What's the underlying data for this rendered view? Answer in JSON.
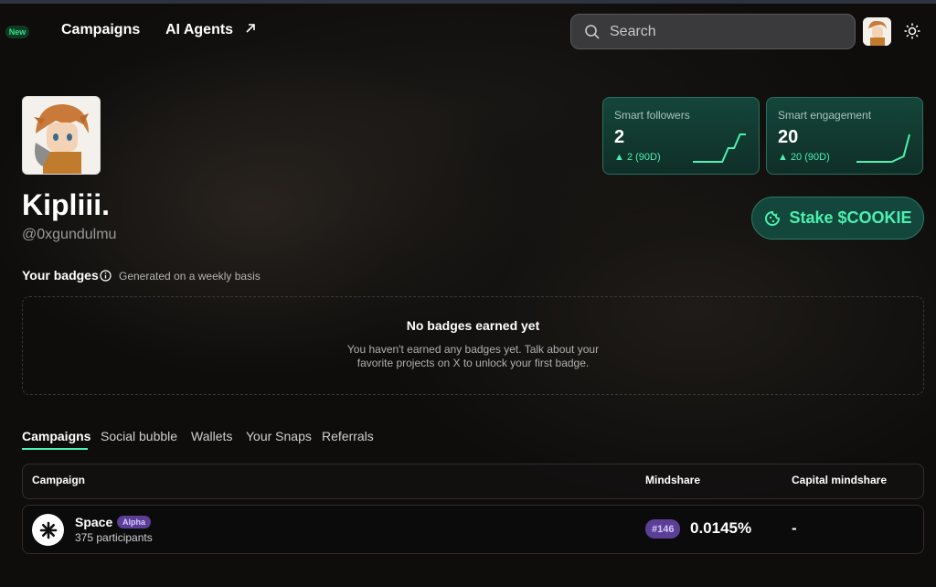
{
  "nav": {
    "new_badge": "New",
    "campaigns": "Campaigns",
    "ai_agents": "AI Agents",
    "ai_agents_icon": "arrow-up-right-icon",
    "search_placeholder": "Search",
    "theme_icon": "sun-icon"
  },
  "profile": {
    "name": "Kipliii.",
    "handle": "@0xgundulmu"
  },
  "stats": [
    {
      "label": "Smart followers",
      "value": "2",
      "change": "▲ 2 (90D)",
      "trend": [
        0,
        0,
        0,
        0,
        0,
        0,
        1,
        1,
        2,
        2
      ]
    },
    {
      "label": "Smart engagement",
      "value": "20",
      "change": "▲ 20 (90D)",
      "trend": [
        0,
        0,
        0,
        0,
        0,
        0,
        0,
        2,
        4,
        20
      ]
    }
  ],
  "stake_button": "Stake $COOKIE",
  "badges": {
    "title": "Your badges",
    "subtitle": "Generated on a weekly basis",
    "empty_title": "No badges earned yet",
    "empty_text": "You haven't earned any badges yet. Talk about your favorite projects on X to unlock your first badge."
  },
  "tabs": [
    "Campaigns",
    "Social bubble",
    "Wallets",
    "Your Snaps",
    "Referrals"
  ],
  "table": {
    "headers": [
      "Campaign",
      "Mindshare",
      "Capital mindshare"
    ],
    "rows": [
      {
        "name": "Space",
        "tag": "Alpha",
        "participants": "375 participants",
        "rank": "#146",
        "mindshare": "0.0145%",
        "capital_mindshare": "-"
      }
    ]
  },
  "colors": {
    "accent": "#4cf0b0",
    "tag": "#5b3e95"
  }
}
